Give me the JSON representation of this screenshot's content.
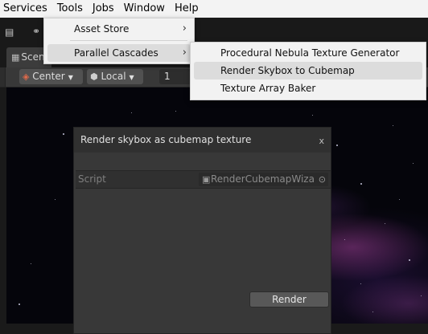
{
  "menubar": {
    "items": [
      "Services",
      "Tools",
      "Jobs",
      "Window",
      "Help"
    ]
  },
  "scene_tab": {
    "label": "Scene"
  },
  "scene_toolbar": {
    "pivot_label": "Center",
    "space_label": "Local",
    "snap_value": "1"
  },
  "tools_menu": {
    "items": [
      {
        "label": "Asset Store",
        "has_submenu": true
      },
      {
        "label": "Parallel Cascades",
        "has_submenu": true,
        "highlighted": true
      }
    ]
  },
  "submenu": {
    "items": [
      {
        "label": "Procedural Nebula Texture Generator"
      },
      {
        "label": "Render Skybox to Cubemap",
        "highlighted": true
      },
      {
        "label": "Texture Array Baker"
      }
    ]
  },
  "dialog": {
    "title": "Render skybox as cubemap texture",
    "close": "x",
    "property_label": "Script",
    "property_value": "RenderCubemapWizard",
    "render_button": "Render"
  },
  "colors": {
    "menu_bg": "#f2f2f2",
    "highlight": "#dcdcdc",
    "dialog_bg": "#383838",
    "editor_dark": "#191919"
  }
}
